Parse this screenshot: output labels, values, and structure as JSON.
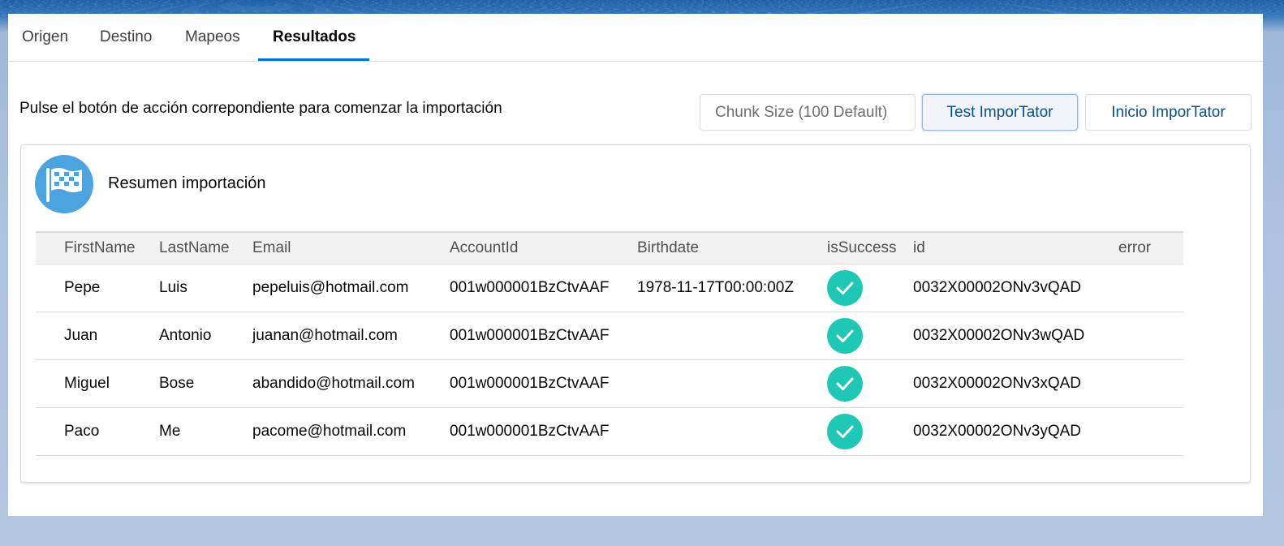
{
  "tabs": [
    {
      "label": "Origen"
    },
    {
      "label": "Destino"
    },
    {
      "label": "Mapeos"
    },
    {
      "label": "Resultados"
    }
  ],
  "active_tab": "Resultados",
  "instruction": "Pulse el botón de acción correpondiente para comenzar la importación",
  "chunk_size": {
    "placeholder": "Chunk Size (100 Default)",
    "value": ""
  },
  "buttons": {
    "test": "Test ImporTator",
    "start": "Inicio ImporTator"
  },
  "summary": {
    "icon": "checkered-flag-icon",
    "title": "Resumen importación",
    "columns": [
      "FirstName",
      "LastName",
      "Email",
      "AccountId",
      "Birthdate",
      "isSuccess",
      "id",
      "error"
    ],
    "rows": [
      {
        "FirstName": "Pepe",
        "LastName": "Luis",
        "Email": "pepeluis@hotmail.com",
        "AccountId": "001w000001BzCtvAAF",
        "Birthdate": "1978-11-17T00:00:00Z",
        "isSuccess": true,
        "id": "0032X00002ONv3vQAD",
        "error": ""
      },
      {
        "FirstName": "Juan",
        "LastName": "Antonio",
        "Email": "juanan@hotmail.com",
        "AccountId": "001w000001BzCtvAAF",
        "Birthdate": "",
        "isSuccess": true,
        "id": "0032X00002ONv3wQAD",
        "error": ""
      },
      {
        "FirstName": "Miguel",
        "LastName": "Bose",
        "Email": "abandido@hotmail.com",
        "AccountId": "001w000001BzCtvAAF",
        "Birthdate": "",
        "isSuccess": true,
        "id": "0032X00002ONv3xQAD",
        "error": ""
      },
      {
        "FirstName": "Paco",
        "LastName": "Me",
        "Email": "pacome@hotmail.com",
        "AccountId": "001w000001BzCtvAAF",
        "Birthdate": "",
        "isSuccess": true,
        "id": "0032X00002ONv3yQAD",
        "error": ""
      }
    ]
  },
  "colors": {
    "accent": "#0070d2",
    "success": "#1ec8b4",
    "icon_badge": "#4ba3e0"
  }
}
